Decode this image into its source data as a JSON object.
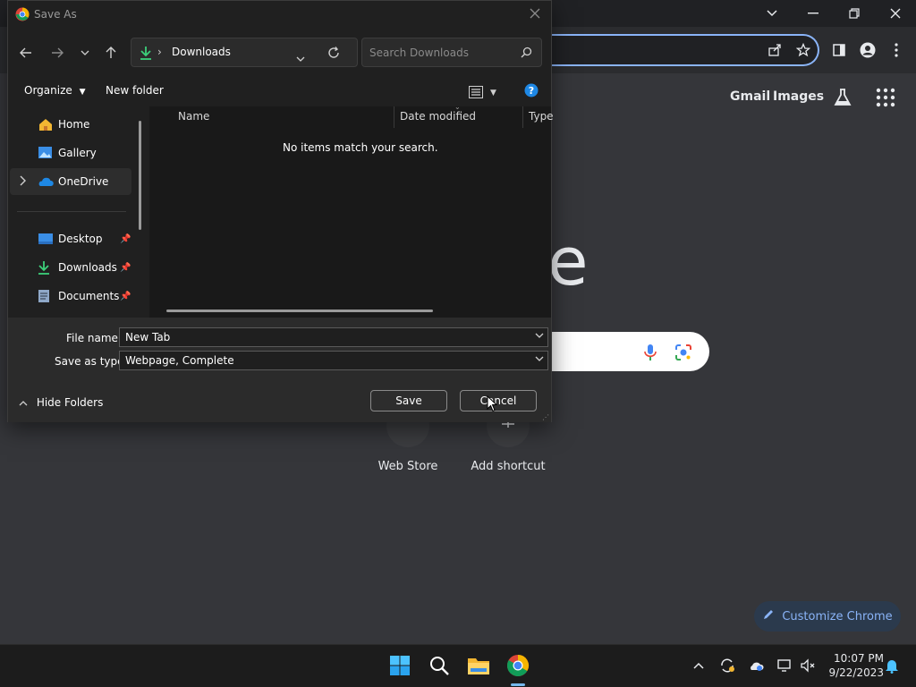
{
  "chrome": {
    "links": [
      "Gmail",
      "Images"
    ],
    "big_letter": "e",
    "shortcuts": [
      "Web Store",
      "Add shortcut"
    ],
    "customize": "Customize Chrome"
  },
  "taskbar": {
    "time": "10:07 PM",
    "date": "9/22/2023"
  },
  "dialog": {
    "title": "Save As",
    "location": "Downloads",
    "search_placeholder": "Search Downloads",
    "toolbar": {
      "organize": "Organize",
      "new_folder": "New folder"
    },
    "nav": {
      "home": "Home",
      "gallery": "Gallery",
      "onedrive": "OneDrive",
      "desktop": "Desktop",
      "downloads": "Downloads",
      "documents": "Documents"
    },
    "columns": [
      "Name",
      "Date modified",
      "Type"
    ],
    "empty_message": "No items match your search.",
    "file_name_label": "File name:",
    "file_name_value": "New Tab",
    "save_type_label": "Save as type:",
    "save_type_value": "Webpage, Complete",
    "hide_folders": "Hide Folders",
    "save": "Save",
    "cancel": "Cancel"
  },
  "colors": {
    "accent": "#8ab4f8",
    "dialog_bg": "#202020",
    "page_bg": "#35363a"
  }
}
